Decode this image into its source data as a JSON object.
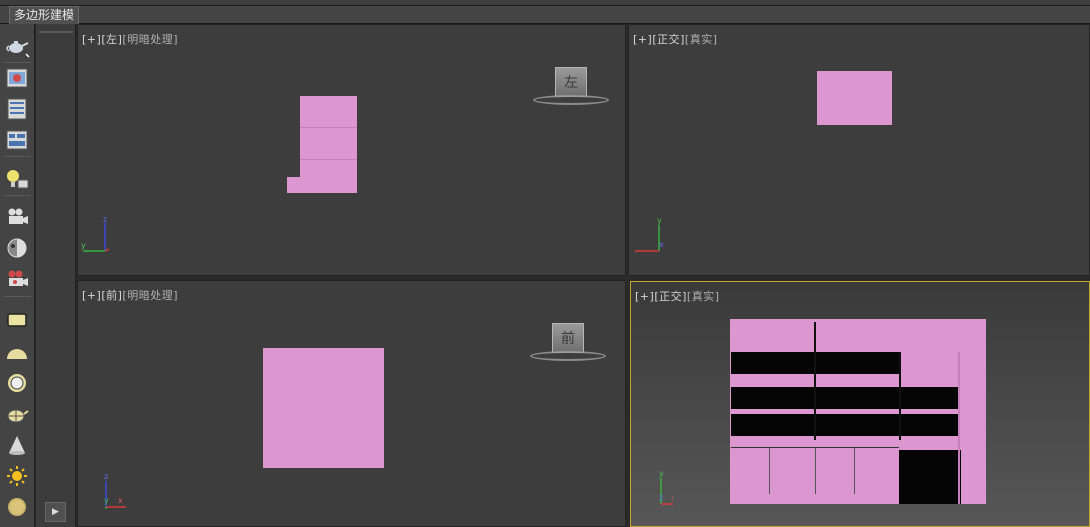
{
  "ribbon": {
    "active_tab": "多边形建模"
  },
  "toolbar": {
    "icons": [
      "teapot-icon",
      "render-frame-icon",
      "render-setup-icon",
      "material-editor-icon",
      "light-lister-icon",
      "camera-icon",
      "viewport-shading-icon",
      "render-icon",
      "rectangle-icon",
      "dome-icon",
      "ring-icon",
      "teapot-mesh-icon",
      "cone-icon",
      "sun-icon",
      "sphere-icon"
    ]
  },
  "side_panel": {
    "play_glyph": "▶"
  },
  "viewports": {
    "top_left": {
      "plus": "[+]",
      "view": "[左]",
      "shading": "[明暗处理]",
      "cube_label": "左",
      "axis": {
        "up": "z",
        "right": "y"
      }
    },
    "top_right": {
      "plus": "[+]",
      "view": "[正交]",
      "shading": "[真实]",
      "axis": {
        "up": "y",
        "right": "x"
      }
    },
    "bottom_left": {
      "plus": "[+]",
      "view": "[前]",
      "shading": "[明暗处理]",
      "cube_label": "前",
      "axis": {
        "up": "z",
        "right": "x"
      }
    },
    "bottom_right": {
      "plus": "[+]",
      "view": "[正交]",
      "shading": "[真实]",
      "axis": {
        "up": "y",
        "right": "x"
      }
    }
  },
  "colors": {
    "object_pink": "#dc96d0",
    "active_border": "#c8a22a",
    "viewport_bg": "#3d3d3d"
  }
}
